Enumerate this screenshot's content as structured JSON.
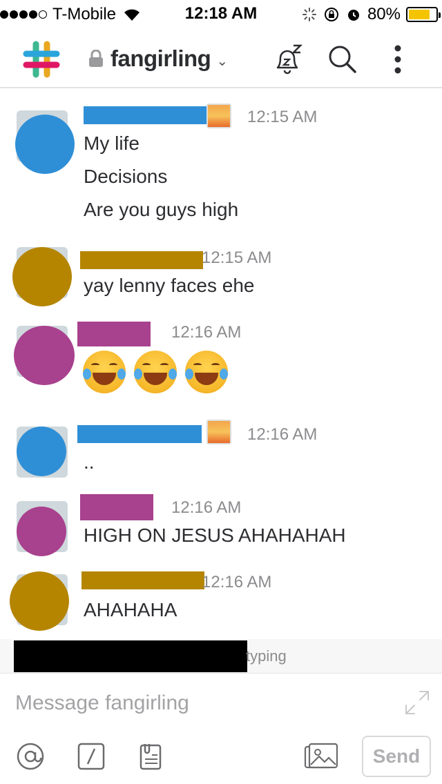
{
  "status_bar": {
    "carrier": "T-Mobile",
    "time": "12:18 AM",
    "battery_percent": "80%",
    "battery_level": 0.8,
    "signal_bars": 4,
    "signal_total": 5
  },
  "header": {
    "channel_name": "fangirling",
    "chevron": "⌄",
    "icons": [
      "slack-logo",
      "lock-icon",
      "snooze-icon",
      "search-icon",
      "more-icon"
    ]
  },
  "messages": [
    {
      "time": "12:15 AM",
      "lines": [
        "My life",
        "Decisions",
        "Are you guys high"
      ]
    },
    {
      "time": "12:15 AM",
      "lines": [
        "yay lenny faces ehe"
      ]
    },
    {
      "time": "12:16 AM",
      "lines": [],
      "emoji_count": 3
    },
    {
      "time": "12:16 AM",
      "lines": [
        ".."
      ]
    },
    {
      "time": "12:16 AM",
      "lines": [
        "HIGH ON JESUS AHAHAHAH"
      ]
    },
    {
      "time": "12:16 AM",
      "lines": [
        "AHAHAHA"
      ]
    }
  ],
  "typing": {
    "text": "typing"
  },
  "composer": {
    "placeholder": "Message fangirling",
    "send_label": "Send",
    "tools": [
      "at-icon",
      "slash-icon",
      "clipboard-icon",
      "image-icon"
    ]
  },
  "colors": {
    "blue": "#2f8fd6",
    "orange": "#b58500",
    "magenta": "#a8418e",
    "accent_yellow": "#f5c400"
  }
}
